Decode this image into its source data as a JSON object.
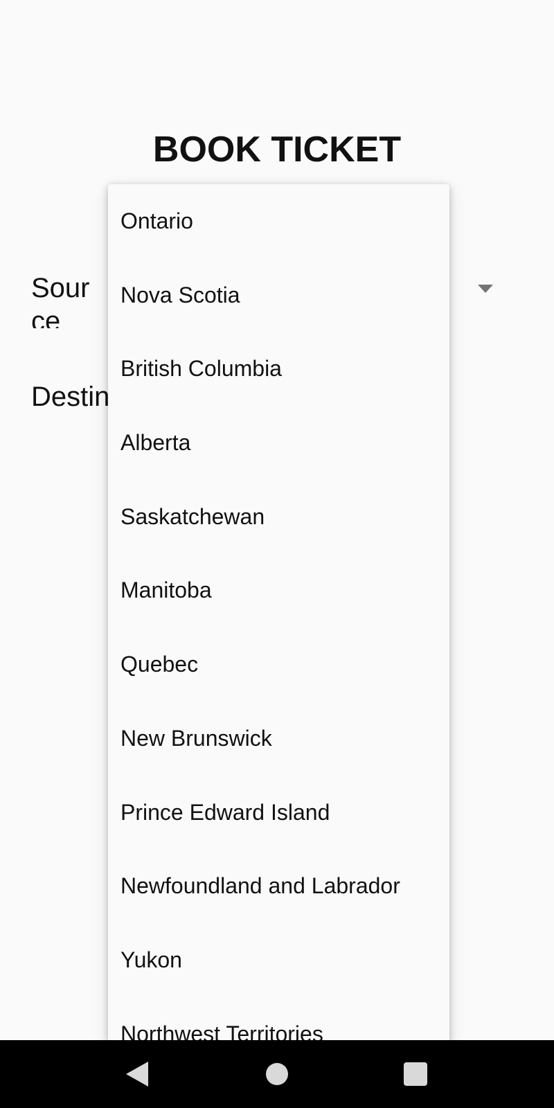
{
  "header": {
    "title": "BOOK TICKET"
  },
  "form": {
    "source_label": "Source",
    "destination_label": "Destination"
  },
  "dropdown": {
    "items": [
      "Ontario",
      "Nova Scotia",
      "British Columbia",
      "Alberta",
      "Saskatchewan",
      "Manitoba",
      "Quebec",
      "New Brunswick",
      "Prince Edward Island",
      "Newfoundland and Labrador",
      "Yukon",
      "Northwest Territories"
    ]
  },
  "nav": {
    "back_icon": "back-triangle-icon",
    "home_icon": "home-circle-icon",
    "recents_icon": "recents-square-icon"
  },
  "colors": {
    "background": "#fafafa",
    "text": "#111111",
    "nav_bar": "#000000",
    "nav_icon": "#d9d9d9",
    "spinner_arrow": "#757575"
  }
}
